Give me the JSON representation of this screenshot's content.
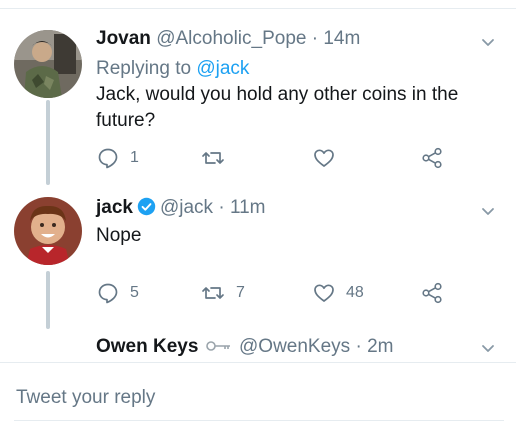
{
  "thread": {
    "tweets": [
      {
        "name": "Jovan",
        "handle": "@Alcoholic_Pope",
        "separator": "·",
        "time": "14m",
        "replying_prefix": "Replying to",
        "replying_to": "@jack",
        "text": "Jack, would you hold any other coins in the future?",
        "reply_count": "1",
        "retweet_count": "",
        "like_count": ""
      },
      {
        "name": "jack",
        "handle": "@jack",
        "separator": "·",
        "time": "11m",
        "text": "Nope",
        "reply_count": "5",
        "retweet_count": "7",
        "like_count": "48"
      },
      {
        "name": "Owen Keys",
        "handle": "@OwenKeys",
        "separator": "·",
        "time": "2m"
      }
    ]
  },
  "reply_box": {
    "placeholder": "Tweet your reply"
  },
  "colors": {
    "accent": "#1da1f2",
    "muted": "#657786",
    "text": "#14171a"
  }
}
